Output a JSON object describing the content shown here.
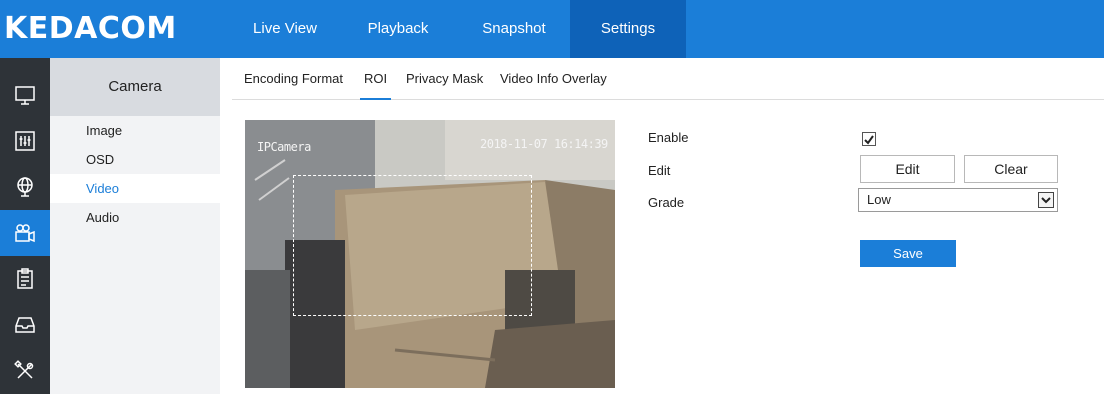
{
  "brand": {
    "logo": "KEDACOM"
  },
  "topnav": {
    "items": [
      "Live View",
      "Playback",
      "Snapshot",
      "Settings"
    ],
    "active": "Settings"
  },
  "sidebar_icons": [
    "monitor-icon",
    "equalizer-icon",
    "globe-icon",
    "camera-icon",
    "clipboard-icon",
    "storage-tray-icon",
    "tools-icon"
  ],
  "subnav": {
    "header": "Camera",
    "items": [
      "Image",
      "OSD",
      "Video",
      "Audio"
    ],
    "active": "Video"
  },
  "tabs": {
    "items": [
      "Encoding Format",
      "ROI",
      "Privacy Mask",
      "Video Info Overlay"
    ],
    "active": "ROI"
  },
  "preview": {
    "osd_name": "IPCamera",
    "osd_time": "2018-11-07 16:14:39"
  },
  "form": {
    "enable_label": "Enable",
    "enable_checked": true,
    "edit_label": "Edit",
    "edit_button": "Edit",
    "clear_button": "Clear",
    "grade_label": "Grade",
    "grade_value": "Low",
    "save_button": "Save"
  },
  "colors": {
    "primary": "#1b7ed8",
    "active_nav": "#0e62b8",
    "iconbar": "#2e3338"
  }
}
